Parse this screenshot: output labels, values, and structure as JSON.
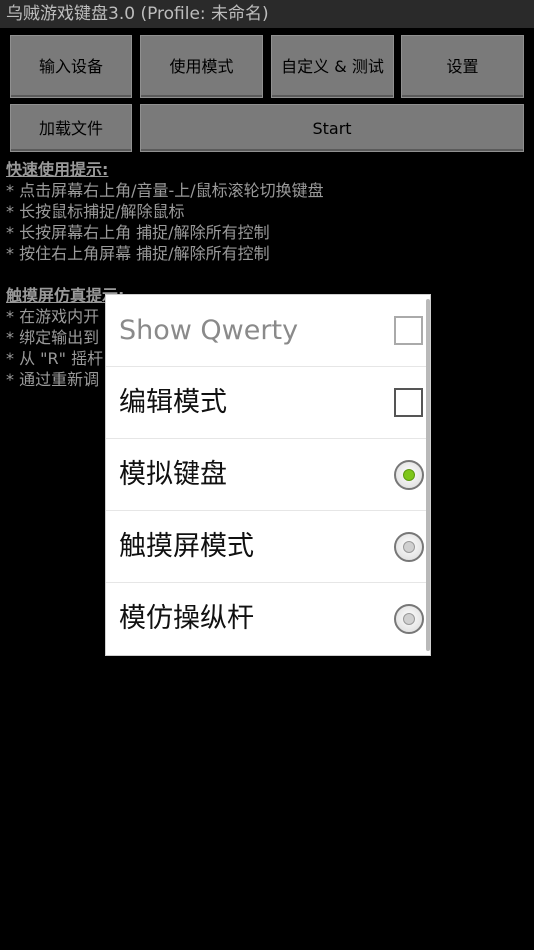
{
  "app": {
    "title": "乌贼游戏键盘3.0 (Profile: 未命名)"
  },
  "toolbar": {
    "input_device": "输入设备",
    "usage_mode": "使用模式",
    "custom_test": "自定义 & 测试",
    "settings": "设置",
    "load_file": "加载文件",
    "start": "Start"
  },
  "tips": {
    "quick_header": "快速使用提示:",
    "quick": [
      "* 点击屏幕右上角/音量-上/鼠标滚轮切换键盘",
      "* 长按鼠标捕捉/解除鼠标",
      "* 长按屏幕右上角 捕捉/解除所有控制",
      "* 按住右上角屏幕 捕捉/解除所有控制"
    ],
    "touch_header": "触摸屏仿真提示:",
    "touch": [
      "* 在游戏内开",
      "* 绑定输出到",
      "* 从 \"R\" 摇杆",
      "* 通过重新调"
    ]
  },
  "dialog": {
    "items": [
      {
        "label": "Show Qwerty",
        "type": "checkbox",
        "checked": false,
        "enabled": false
      },
      {
        "label": "编辑模式",
        "type": "checkbox",
        "checked": false,
        "enabled": true
      },
      {
        "label": "模拟键盘",
        "type": "radio",
        "checked": true,
        "enabled": true
      },
      {
        "label": "触摸屏模式",
        "type": "radio",
        "checked": false,
        "enabled": true
      },
      {
        "label": "模仿操纵杆",
        "type": "radio",
        "checked": false,
        "enabled": true
      }
    ]
  }
}
